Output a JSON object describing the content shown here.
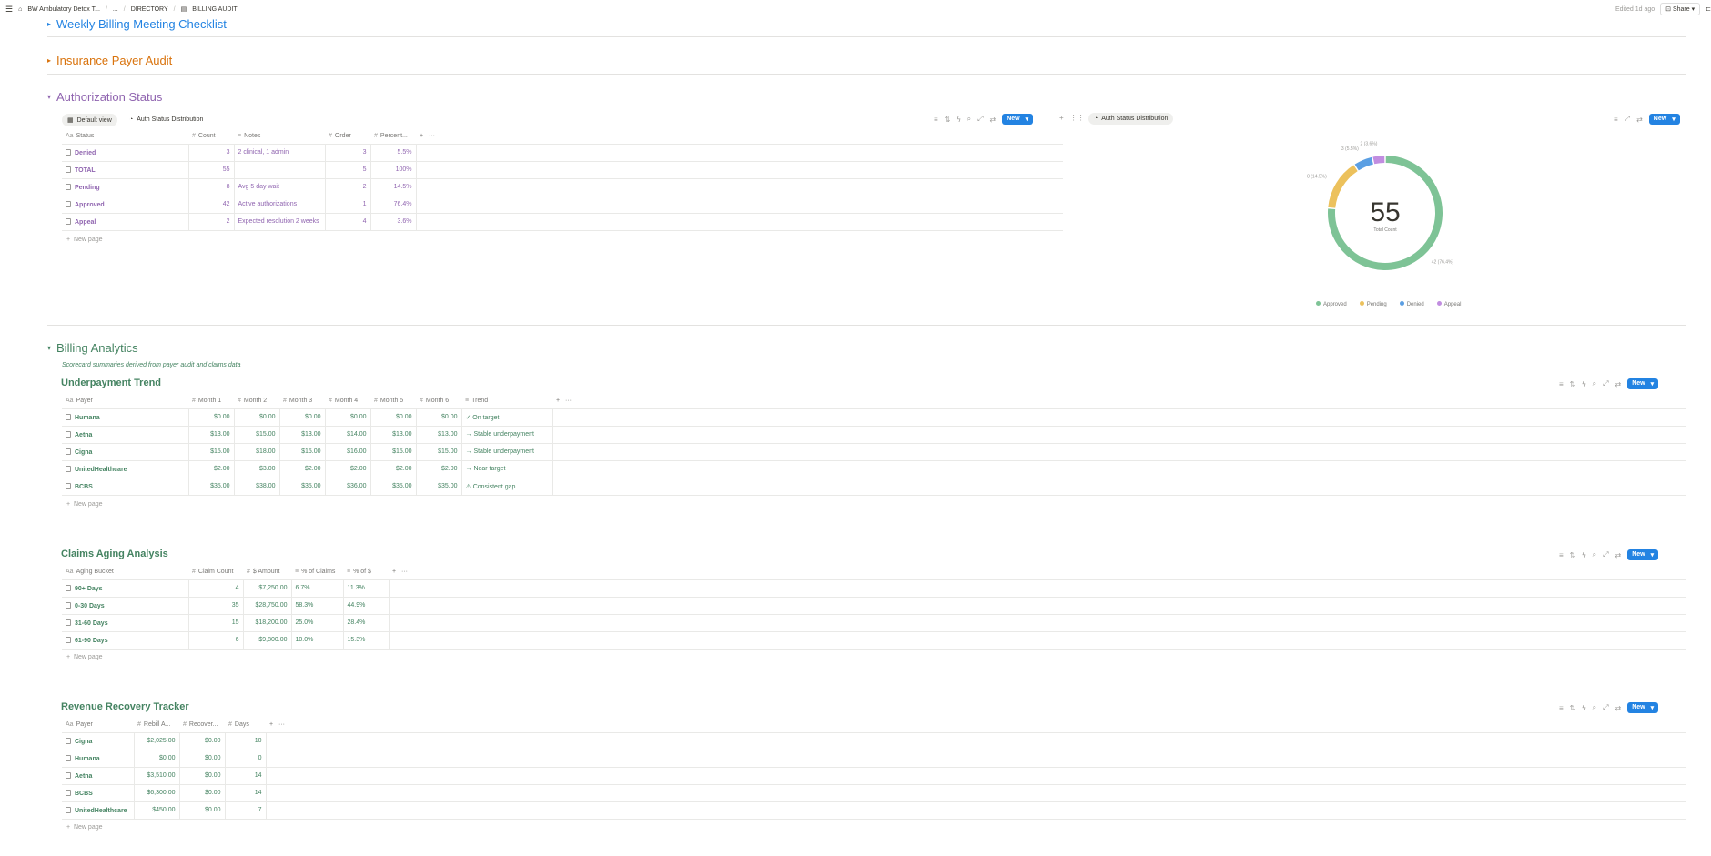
{
  "topbar": {
    "crumbs": [
      "BW Ambulatory Detox T...",
      "...",
      "DIRECTORY",
      "BILLING AUDIT"
    ],
    "edited": "Edited 1d ago",
    "share": "Share"
  },
  "sections": {
    "weekly": "Weekly Billing Meeting Checklist",
    "insurance": "Insurance Payer Audit",
    "authorization": "Authorization Status",
    "billing": "Billing Analytics",
    "billing_subtitle": "Scorecard summaries derived from payer audit and claims data"
  },
  "colors": {
    "blue": "#2383e2",
    "orange": "#d9730d",
    "purple": "#9065b0",
    "green": "#448361"
  },
  "new_button": "New",
  "new_page": "New page",
  "auth": {
    "view_default": "Default view",
    "view_chart": "Auth Status Distribution",
    "chart_tab": "Auth Status Distribution",
    "columns": [
      "Status",
      "Count",
      "Notes",
      "Order",
      "Percent..."
    ],
    "rows": [
      {
        "status": "Denied",
        "count": "3",
        "notes": "2 clinical, 1 admin",
        "order": "3",
        "percent": "5.5%"
      },
      {
        "status": "TOTAL",
        "count": "55",
        "notes": "",
        "order": "5",
        "percent": "100%"
      },
      {
        "status": "Pending",
        "count": "8",
        "notes": "Avg 5 day wait",
        "order": "2",
        "percent": "14.5%"
      },
      {
        "status": "Approved",
        "count": "42",
        "notes": "Active authorizations",
        "order": "1",
        "percent": "76.4%"
      },
      {
        "status": "Appeal",
        "count": "2",
        "notes": "Expected resolution 2 weeks",
        "order": "4",
        "percent": "3.6%"
      }
    ]
  },
  "chart_data": {
    "type": "pie",
    "categories": [
      "Approved",
      "Pending",
      "Denied",
      "Appeal"
    ],
    "values": [
      42,
      8,
      3,
      2
    ],
    "colors": [
      "#7ec396",
      "#ecc15c",
      "#5b9fe3",
      "#c18de0"
    ],
    "slice_labels": [
      "42 (76.4%)",
      "8 (14.5%)",
      "3 (5.5%)",
      "2 (3.6%)"
    ],
    "center_value": "55",
    "center_label": "Total Count",
    "legend_position": "bottom"
  },
  "underpayment": {
    "title": "Underpayment Trend",
    "columns": [
      "Payer",
      "Month 1",
      "Month 2",
      "Month 3",
      "Month 4",
      "Month 5",
      "Month 6",
      "Trend"
    ],
    "rows": [
      {
        "payer": "Humana",
        "m": [
          "$0.00",
          "$0.00",
          "$0.00",
          "$0.00",
          "$0.00",
          "$0.00"
        ],
        "trend": "✓ On target"
      },
      {
        "payer": "Aetna",
        "m": [
          "$13.00",
          "$15.00",
          "$13.00",
          "$14.00",
          "$13.00",
          "$13.00"
        ],
        "trend": "→ Stable underpayment"
      },
      {
        "payer": "Cigna",
        "m": [
          "$15.00",
          "$18.00",
          "$15.00",
          "$16.00",
          "$15.00",
          "$15.00"
        ],
        "trend": "→ Stable underpayment"
      },
      {
        "payer": "UnitedHealthcare",
        "m": [
          "$2.00",
          "$3.00",
          "$2.00",
          "$2.00",
          "$2.00",
          "$2.00"
        ],
        "trend": "→ Near target"
      },
      {
        "payer": "BCBS",
        "m": [
          "$35.00",
          "$38.00",
          "$35.00",
          "$36.00",
          "$35.00",
          "$35.00"
        ],
        "trend": "⚠ Consistent gap"
      }
    ]
  },
  "aging": {
    "title": "Claims Aging Analysis",
    "columns": [
      "Aging Bucket",
      "Claim Count",
      "$ Amount",
      "% of Claims",
      "% of $"
    ],
    "rows": [
      {
        "bucket": "90+ Days",
        "count": "4",
        "amount": "$7,250.00",
        "pct_claims": "6.7%",
        "pct_amount": "11.3%"
      },
      {
        "bucket": "0-30 Days",
        "count": "35",
        "amount": "$28,750.00",
        "pct_claims": "58.3%",
        "pct_amount": "44.9%"
      },
      {
        "bucket": "31-60 Days",
        "count": "15",
        "amount": "$18,200.00",
        "pct_claims": "25.0%",
        "pct_amount": "28.4%"
      },
      {
        "bucket": "61-90 Days",
        "count": "6",
        "amount": "$9,800.00",
        "pct_claims": "10.0%",
        "pct_amount": "15.3%"
      }
    ]
  },
  "recovery": {
    "title": "Revenue Recovery Tracker",
    "columns": [
      "Payer",
      "Rebill A...",
      "Recover...",
      "Days"
    ],
    "rows": [
      {
        "payer": "Cigna",
        "rebill": "$2,025.00",
        "recovered": "$0.00",
        "days": "10"
      },
      {
        "payer": "Humana",
        "rebill": "$0.00",
        "recovered": "$0.00",
        "days": "0"
      },
      {
        "payer": "Aetna",
        "rebill": "$3,510.00",
        "recovered": "$0.00",
        "days": "14"
      },
      {
        "payer": "BCBS",
        "rebill": "$6,300.00",
        "recovered": "$0.00",
        "days": "14"
      },
      {
        "payer": "UnitedHealthcare",
        "rebill": "$450.00",
        "recovered": "$0.00",
        "days": "7"
      }
    ]
  }
}
